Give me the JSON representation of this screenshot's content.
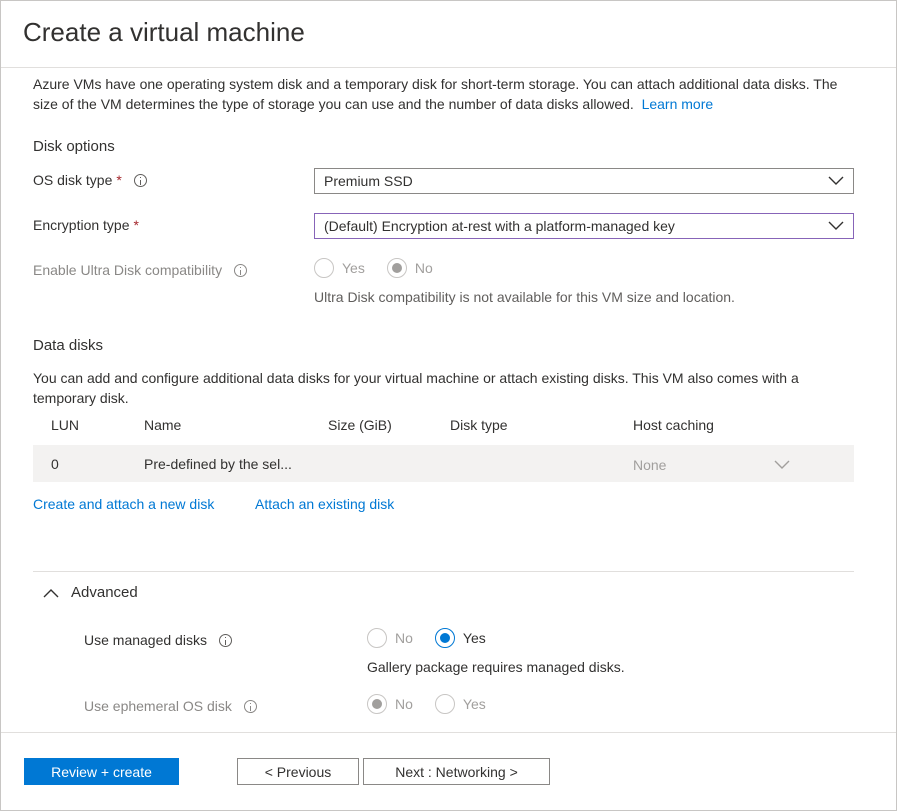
{
  "window": {
    "title": "Create a virtual machine"
  },
  "intro": {
    "text": "Azure VMs have one operating system disk and a temporary disk for short-term storage. You can attach additional data disks. The size of the VM determines the type of storage you can use and the number of data disks allowed.",
    "link": "Learn more"
  },
  "disk_options": {
    "heading": "Disk options",
    "os_disk_type": {
      "label": "OS disk type",
      "required_mark": "*",
      "value": "Premium SSD"
    },
    "encryption_type": {
      "label": "Encryption type",
      "required_mark": "*",
      "value": "(Default) Encryption at-rest with a platform-managed key"
    },
    "ultra_disk": {
      "label": "Enable Ultra Disk compatibility",
      "options": [
        "Yes",
        "No"
      ],
      "selected": "No",
      "note": "Ultra Disk compatibility is not available for this VM size and location."
    }
  },
  "data_disks": {
    "heading": "Data disks",
    "description": "You can add and configure additional data disks for your virtual machine or attach existing disks. This VM also comes with a temporary disk.",
    "columns": [
      "LUN",
      "Name",
      "Size (GiB)",
      "Disk type",
      "Host caching"
    ],
    "rows": [
      {
        "lun": "0",
        "name": "Pre-defined by the sel...",
        "size": "",
        "disk_type": "",
        "host_caching": "None"
      }
    ],
    "create_link": "Create and attach a new disk",
    "attach_link": "Attach an existing disk"
  },
  "advanced": {
    "heading": "Advanced",
    "managed_disks": {
      "label": "Use managed disks",
      "options": [
        "No",
        "Yes"
      ],
      "selected": "Yes",
      "note": "Gallery package requires managed disks."
    },
    "ephemeral_os_disk": {
      "label": "Use ephemeral OS disk",
      "options": [
        "No",
        "Yes"
      ],
      "selected": "No"
    }
  },
  "footer": {
    "review_create": "Review + create",
    "previous": "< Previous",
    "next": "Next : Networking >"
  },
  "colors": {
    "accent": "#0078d4",
    "required": "#a4262c",
    "focus_border": "#8764b8"
  }
}
